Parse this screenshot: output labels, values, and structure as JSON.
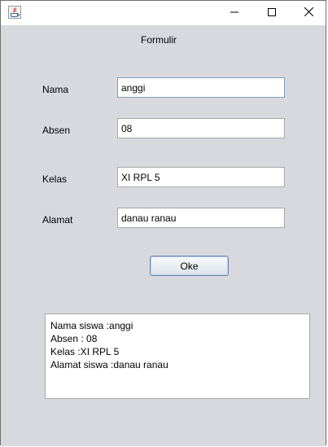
{
  "form": {
    "title": "Formulir",
    "fields": [
      {
        "label": "Nama",
        "value": "anggi"
      },
      {
        "label": "Absen",
        "value": "08"
      },
      {
        "label": "Kelas",
        "value": "XI RPL 5"
      },
      {
        "label": "Alamat",
        "value": "danau ranau"
      }
    ],
    "submit_label": "Oke"
  },
  "output": {
    "lines": [
      "Nama siswa :anggi",
      "Absen : 08",
      "Kelas :XI RPL 5",
      "Alamat siswa :danau ranau"
    ]
  },
  "titlebar": {
    "icons": [
      "java-app-icon",
      "minimize-icon",
      "maximize-icon",
      "close-icon"
    ]
  }
}
